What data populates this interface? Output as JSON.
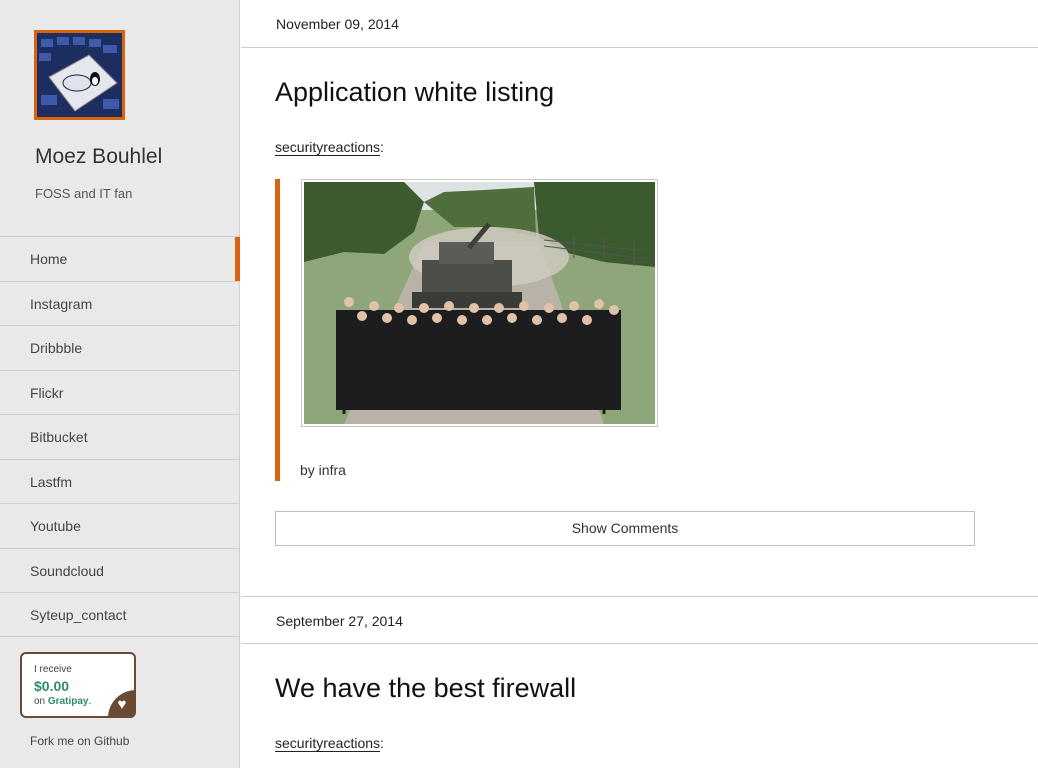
{
  "sidebar": {
    "name": "Moez Bouhlel",
    "tagline": "FOSS and IT fan",
    "nav": [
      {
        "label": "Home",
        "active": true
      },
      {
        "label": "Instagram"
      },
      {
        "label": "Dribbble"
      },
      {
        "label": "Flickr"
      },
      {
        "label": "Bitbucket"
      },
      {
        "label": "Lastfm"
      },
      {
        "label": "Youtube"
      },
      {
        "label": "Soundcloud"
      },
      {
        "label": "Syteup_contact"
      }
    ],
    "gratipay": {
      "line1": "I receive",
      "amount": "$0.00",
      "on": "on",
      "brand": "Gratipay",
      "period": "."
    },
    "fork": "Fork me on Github"
  },
  "posts": [
    {
      "date": "November 09, 2014",
      "title": "Application white listing",
      "source": "securityreactions",
      "source_suffix": ":",
      "byline": "by infra",
      "comments_button": "Show Comments"
    },
    {
      "date": "September 27, 2014",
      "title": "We have the best firewall",
      "source": "securityreactions",
      "source_suffix": ":"
    }
  ],
  "colors": {
    "accent": "#d9640f",
    "sidebar_bg": "#e9e9e9",
    "gratipay_green": "#2f8b6f",
    "gratipay_brown": "#6b4a34"
  }
}
